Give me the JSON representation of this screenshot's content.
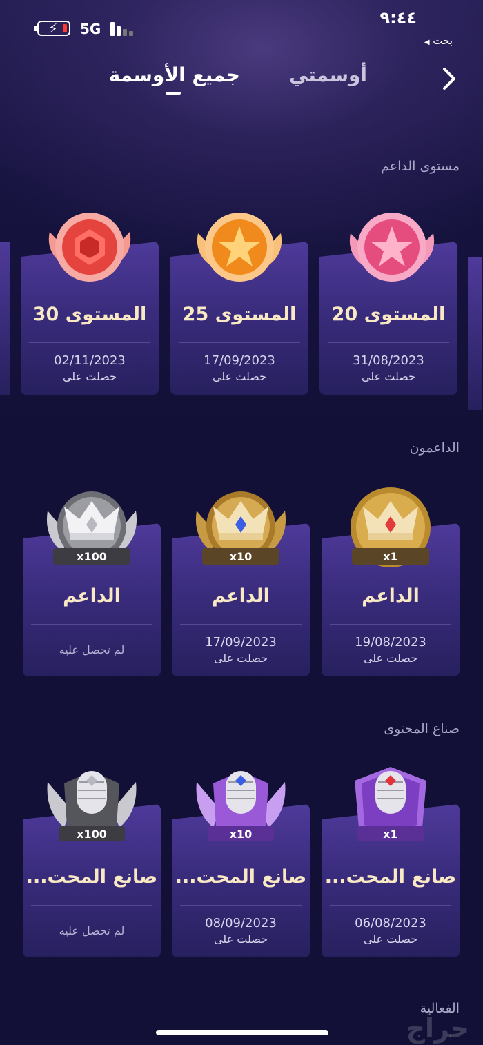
{
  "status_bar": {
    "time": "٩:٤٤",
    "back_app": "بحث",
    "network": "5G",
    "battery_level": 0.1,
    "battery_charging": true,
    "signal_bars": 2
  },
  "tabs": {
    "all_badges": "جميع الأوسمة",
    "my_badges": "أوسمتي",
    "active": "all_badges"
  },
  "sections": [
    {
      "title": "مستوى الداعم",
      "cards": [
        {
          "title": "المستوى 20",
          "date": "31/08/2023",
          "status": "حصلت على",
          "badge": "pink-star-medal-icon"
        },
        {
          "title": "المستوى 25",
          "date": "17/09/2023",
          "status": "حصلت على",
          "badge": "orange-star-medal-icon"
        },
        {
          "title": "المستوى 30",
          "date": "02/11/2023",
          "status": "حصلت على",
          "badge": "red-gem-medal-icon"
        }
      ]
    },
    {
      "title": "الداعمون",
      "cards": [
        {
          "title": "الداعم",
          "date": "19/08/2023",
          "status": "حصلت على",
          "badge_text": "x1",
          "badge": "gold-crown-icon"
        },
        {
          "title": "الداعم",
          "date": "17/09/2023",
          "status": "حصلت على",
          "badge_text": "x10",
          "badge": "gold-winged-crown-icon"
        },
        {
          "title": "الداعم",
          "date": "",
          "status": "لم تحصل عليه",
          "badge_text": "x100",
          "badge": "silver-winged-crown-icon"
        }
      ]
    },
    {
      "title": "صناع المحتوى",
      "cards": [
        {
          "title": "صانع المحت...",
          "date": "06/08/2023",
          "status": "حصلت على",
          "badge_text": "x1",
          "badge": "purple-microphone-icon"
        },
        {
          "title": "صانع المحت...",
          "date": "08/09/2023",
          "status": "حصلت على",
          "badge_text": "x10",
          "badge": "purple-winged-microphone-icon"
        },
        {
          "title": "صانع المحت...",
          "date": "",
          "status": "لم تحصل عليه",
          "badge_text": "x100",
          "badge": "silver-winged-microphone-icon"
        }
      ]
    }
  ],
  "next_section_title": "الفعالية",
  "watermark": "حراج",
  "colors": {
    "background": "#13113a",
    "card_top": "#4e3a9a",
    "card_bottom": "#27205e",
    "title_text": "#f8e8c4"
  }
}
